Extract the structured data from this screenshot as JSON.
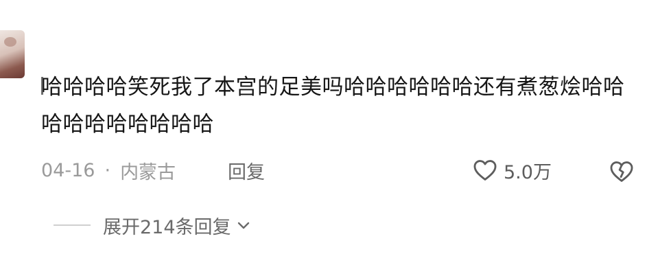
{
  "comment": {
    "text": "哈哈哈哈笑死我了本宫的足美吗哈哈哈哈哈哈还有煮葱烩哈哈哈哈哈哈哈哈哈哈",
    "date": "04-16",
    "separator": "·",
    "location": "内蒙古",
    "reply_label": "回复",
    "like_count": "5.0万"
  },
  "replies": {
    "expand_label": "展开214条回复"
  },
  "icons": {
    "like": "heart-outline-icon",
    "dislike": "broken-heart-icon",
    "expand": "chevron-down-icon"
  }
}
